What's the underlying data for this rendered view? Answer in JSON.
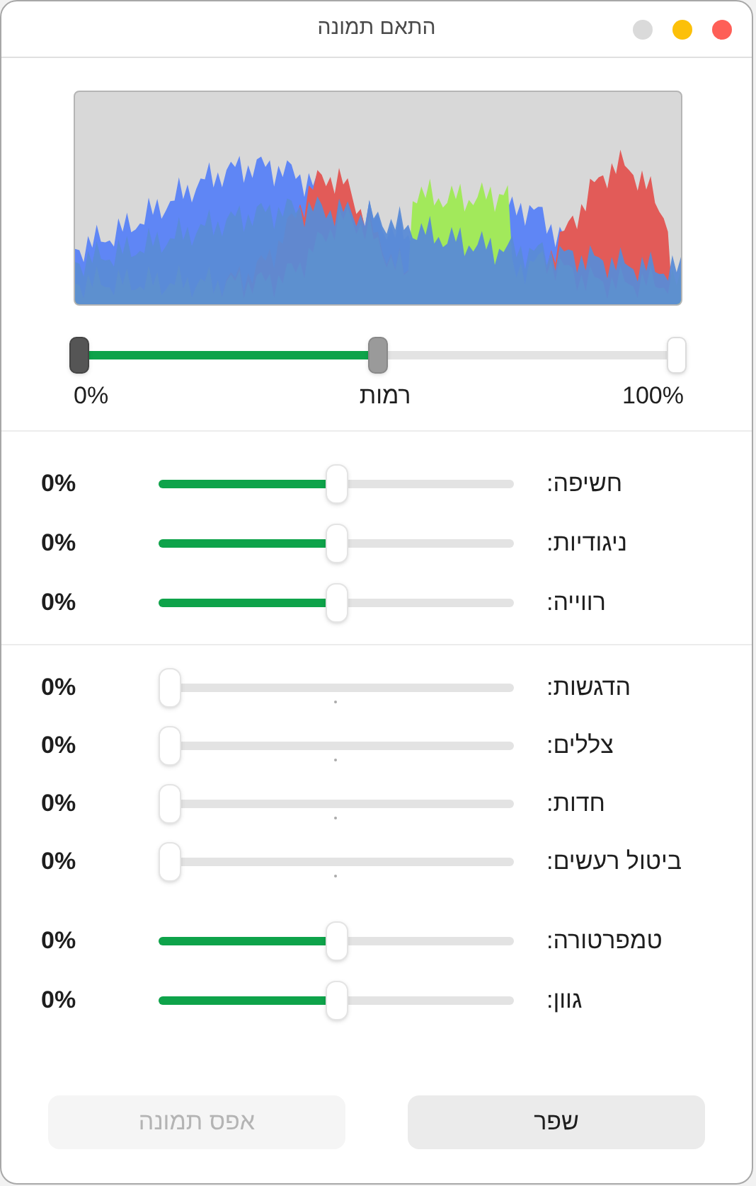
{
  "window": {
    "title": "התאם תמונה"
  },
  "levels": {
    "thumbs": [
      {
        "kind": "black",
        "level": 0
      },
      {
        "kind": "gray",
        "level": 0.5
      },
      {
        "kind": "white",
        "level": 1
      }
    ],
    "min_label": "0%",
    "label": "רמות",
    "max_label": "100%"
  },
  "groups": [
    {
      "sliders": [
        {
          "label": "חשיפה:",
          "kind": "centered",
          "level": 0.5,
          "value": "0%"
        },
        {
          "label": "ניגודיות:",
          "kind": "centered",
          "level": 0.5,
          "value": "0%"
        },
        {
          "label": "רווייה:",
          "kind": "centered",
          "level": 0.5,
          "value": "0%"
        }
      ]
    },
    {
      "sliders": [
        {
          "label": "הדגשות:",
          "kind": "plain",
          "level": 0,
          "value": "0%"
        },
        {
          "label": "צללים:",
          "kind": "plain",
          "level": 0,
          "value": "0%"
        },
        {
          "label": "חדות:",
          "kind": "plain",
          "level": 0,
          "value": "0%"
        },
        {
          "label": "ביטול רעשים:",
          "kind": "plain",
          "level": 0,
          "value": "0%"
        }
      ]
    },
    {
      "sliders": [
        {
          "label": "טמפרטורה:",
          "kind": "centered",
          "level": 0.5,
          "value": "0%"
        },
        {
          "label": "גוון:",
          "kind": "centered",
          "level": 0.5,
          "value": "0%"
        }
      ]
    }
  ],
  "buttons": [
    {
      "label": "שפר",
      "disabled": false
    },
    {
      "label": "אפס תמונה",
      "disabled": true
    }
  ]
}
